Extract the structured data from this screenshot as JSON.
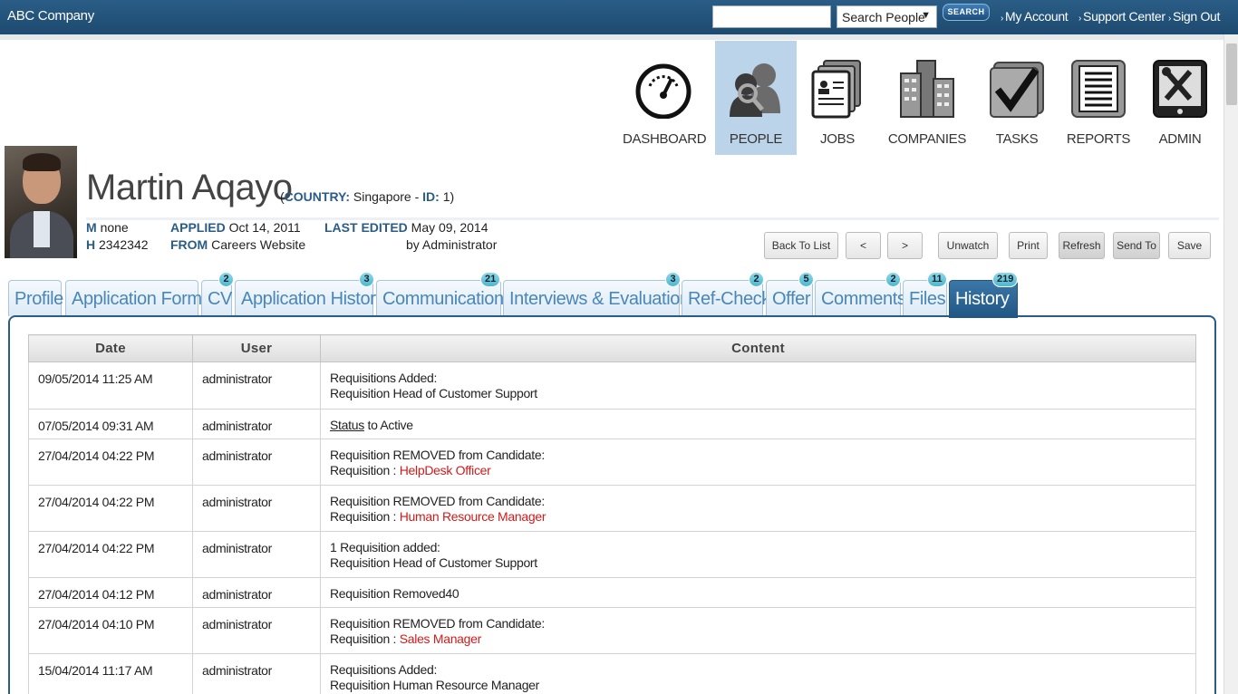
{
  "topbar": {
    "brand": "ABC Company",
    "search_value": "",
    "search_scope": "Search People",
    "search_button": "SEARCH",
    "links": [
      "My Account",
      "Support Center",
      "Sign Out"
    ]
  },
  "modules": [
    {
      "label": "DASHBOARD",
      "icon": "dashboard-gauge-icon"
    },
    {
      "label": "PEOPLE",
      "icon": "people-icon",
      "active": true
    },
    {
      "label": "JOBS",
      "icon": "jobs-cards-icon"
    },
    {
      "label": "COMPANIES",
      "icon": "companies-buildings-icon"
    },
    {
      "label": "TASKS",
      "icon": "tasks-checkbox-icon"
    },
    {
      "label": "REPORTS",
      "icon": "reports-document-icon"
    },
    {
      "label": "ADMIN",
      "icon": "admin-tools-icon"
    }
  ],
  "person": {
    "name": "Martin Aqayo",
    "country_label": "COUNTRY:",
    "country": "Singapore",
    "id_label": "ID:",
    "id": "1",
    "m_label": "M",
    "m_value": "none",
    "h_label": "H",
    "h_value": "2342342",
    "applied_label": "APPLIED",
    "applied": "Oct 14, 2011",
    "from_label": "FROM",
    "from": "Careers Website",
    "last_edited_label": "LAST EDITED",
    "last_edited": "May 09, 2014",
    "edited_by": "by Administrator"
  },
  "actions": {
    "back": "Back To List",
    "prev": "<",
    "next": ">",
    "unwatch": "Unwatch",
    "print": "Print",
    "refresh": "Refresh",
    "send_to": "Send To",
    "save": "Save"
  },
  "tabs": [
    {
      "label": "Profile",
      "badge": ""
    },
    {
      "label": "Application Forms",
      "badge": ""
    },
    {
      "label": "CV",
      "badge": "2"
    },
    {
      "label": "Application History",
      "badge": "3"
    },
    {
      "label": "Communication",
      "badge": "21"
    },
    {
      "label": "Interviews & Evaluations",
      "badge": "3"
    },
    {
      "label": "Ref-Check",
      "badge": "2"
    },
    {
      "label": "Offer",
      "badge": "5"
    },
    {
      "label": "Comments",
      "badge": "2"
    },
    {
      "label": "Files",
      "badge": "11"
    },
    {
      "label": "History",
      "badge": "219",
      "active": true
    }
  ],
  "history": {
    "columns": [
      "Date",
      "User",
      "Content"
    ],
    "rows": [
      {
        "date": "09/05/2014 11:25 AM",
        "user": "administrator",
        "line1": "Requisitions Added:",
        "line2": "Requisition Head of Customer Support"
      },
      {
        "date": "07/05/2014 09:31 AM",
        "user": "administrator",
        "status_word": "Status",
        "line1": " to Active"
      },
      {
        "date": "27/04/2014 04:22 PM",
        "user": "administrator",
        "line1": "Requisition REMOVED from Candidate:",
        "line2": "Requisition : ",
        "link": "HelpDesk Officer"
      },
      {
        "date": "27/04/2014 04:22 PM",
        "user": "administrator",
        "line1": "Requisition REMOVED from Candidate:",
        "line2": "Requisition : ",
        "link": "Human Resource Manager"
      },
      {
        "date": "27/04/2014 04:22 PM",
        "user": "administrator",
        "line1": "1 Requisition added:",
        "line2": "Requisition Head of Customer Support"
      },
      {
        "date": "27/04/2014 04:12 PM",
        "user": "administrator",
        "line1": "Requisition Removed40"
      },
      {
        "date": "27/04/2014 04:10 PM",
        "user": "administrator",
        "line1": "Requisition REMOVED from Candidate:",
        "line2": "Requisition : ",
        "link": "Sales Manager"
      },
      {
        "date": "15/04/2014 11:17 AM",
        "user": "administrator",
        "line1": "Requisitions Added:",
        "line2": "Requisition Human Resource Manager"
      }
    ]
  },
  "colors": {
    "topbar": "#1d4a70",
    "accent": "#2a5d86",
    "tab_text": "#4a86b8",
    "link_red": "#d01b1b",
    "active_module": "#bcd4ea"
  }
}
